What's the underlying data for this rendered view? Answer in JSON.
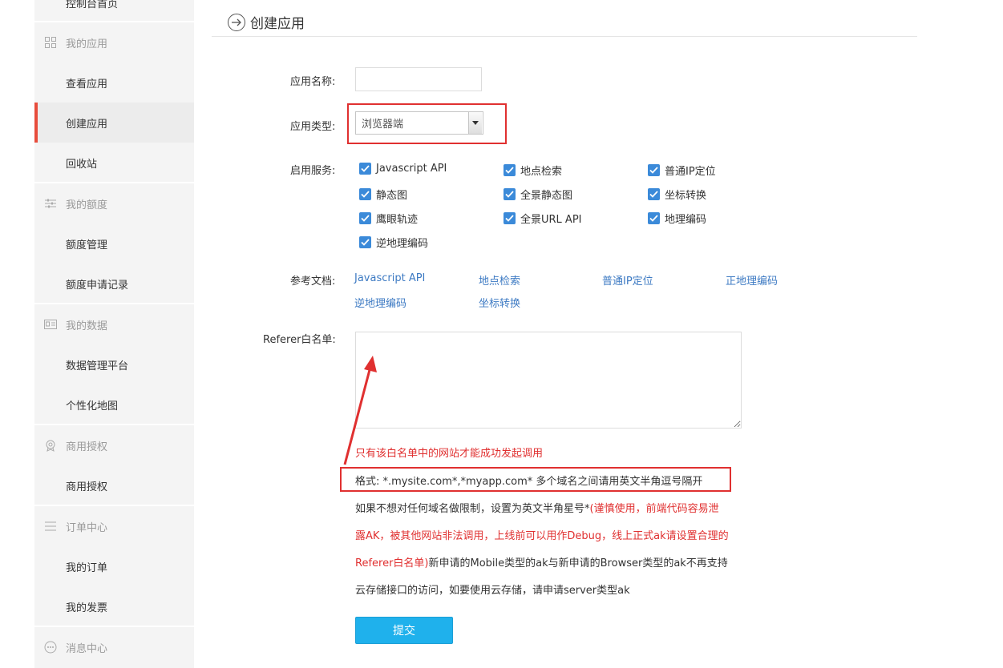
{
  "sidebar": {
    "top_partial_label": "控制台首页",
    "groups": [
      {
        "title": "我的应用",
        "icon": "grid-icon",
        "items": [
          "查看应用",
          "创建应用",
          "回收站"
        ]
      },
      {
        "title": "我的额度",
        "icon": "sliders-icon",
        "items": [
          "额度管理",
          "额度申请记录"
        ]
      },
      {
        "title": "我的数据",
        "icon": "id-card-icon",
        "items": [
          "数据管理平台",
          "个性化地图"
        ]
      },
      {
        "title": "商用授权",
        "icon": "badge-icon",
        "items": [
          "商用授权"
        ]
      },
      {
        "title": "订单中心",
        "icon": "list-icon",
        "items": [
          "我的订单",
          "我的发票"
        ]
      },
      {
        "title": "消息中心",
        "icon": "chat-icon",
        "items": []
      }
    ],
    "active_item": "创建应用"
  },
  "header": {
    "title": "创建应用",
    "icon": "arrow-circle-icon"
  },
  "form": {
    "name_label": "应用名称:",
    "name_value": "",
    "type_label": "应用类型:",
    "type_value": "浏览器端",
    "services_label": "启用服务:",
    "services": [
      {
        "label": "Javascript API",
        "checked": true
      },
      {
        "label": "地点检索",
        "checked": true
      },
      {
        "label": "普通IP定位",
        "checked": true
      },
      {
        "label": "静态图",
        "checked": true
      },
      {
        "label": "全景静态图",
        "checked": true
      },
      {
        "label": "坐标转换",
        "checked": true
      },
      {
        "label": "鹰眼轨迹",
        "checked": true
      },
      {
        "label": "全景URL API",
        "checked": true
      },
      {
        "label": "地理编码",
        "checked": true
      },
      {
        "label": "逆地理编码",
        "checked": true
      }
    ],
    "docs_label": "参考文档:",
    "docs": [
      "Javascript API",
      "地点检索",
      "普通IP定位",
      "正地理编码",
      "逆地理编码",
      "坐标转换"
    ],
    "referer_label": "Referer白名单:",
    "referer_value": "",
    "hint_red": "只有该白名单中的网站才能成功发起调用",
    "format_text": "格式: *.mysite.com*,*myapp.com* 多个域名之间请用英文半角逗号隔开",
    "para1_normal": "如果不想对任何域名做限制，设置为英文半角星号*",
    "para1_red": "(谨慎使用，前端代码容易泄",
    "para2_red": "露AK，被其他网站非法调用，上线前可以用作Debug，线上正式ak请设置合理的",
    "para3_red": "Referer白名单)",
    "para3_normal": "新申请的Mobile类型的ak与新申请的Browser类型的ak不再支持",
    "para4_normal": "云存储接口的访问，如要使用云存储，请申请server类型ak",
    "submit_label": "提交"
  },
  "colors": {
    "accent": "#1fb1ec",
    "annotation_red": "#e03030",
    "checkbox": "#3b8ad9",
    "link": "#3d7ac3"
  }
}
